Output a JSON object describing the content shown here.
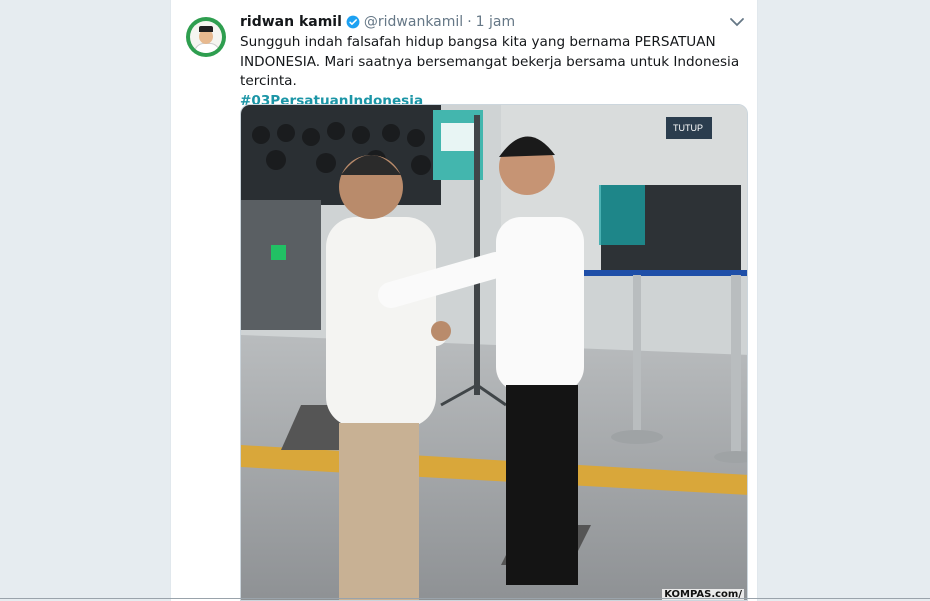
{
  "tweet": {
    "author_name": "ridwan kamil",
    "handle": "@ridwankamil",
    "separator": "·",
    "time": "1 jam",
    "text": "Sungguh indah falsafah hidup bangsa kita yang bernama PERSATUAN INDONESIA. Mari saatnya bersemangat bekerja bersama untuk Indonesia tercinta.",
    "hashtag": "#03PersatuanIndonesia",
    "photo_credit": "KOMPAS.com/",
    "sign_tutup": "TUTUP"
  },
  "colors": {
    "accent": "#1b95a6",
    "verified": "#1da1f2",
    "avatar_ring": "#2e9e4f"
  },
  "icons": [
    "verified-badge-icon",
    "chevron-down-icon"
  ]
}
